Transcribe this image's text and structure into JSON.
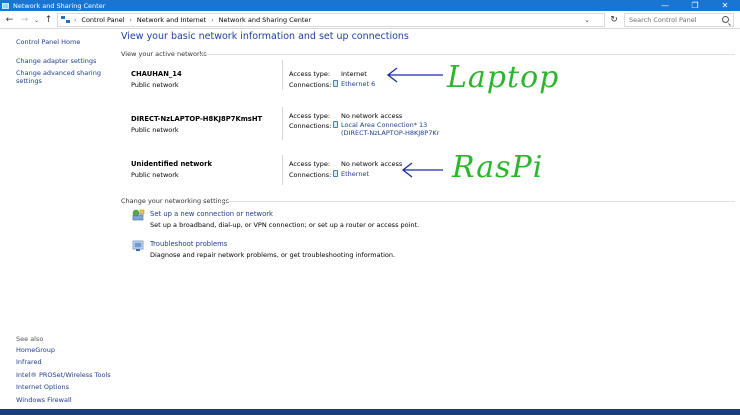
{
  "window": {
    "title": "Network and Sharing Center"
  },
  "breadcrumb": [
    "Control Panel",
    "Network and Internet",
    "Network and Sharing Center"
  ],
  "search": {
    "placeholder": "Search Control Panel"
  },
  "sidebar": {
    "home": "Control Panel Home",
    "adapter": "Change adapter settings",
    "advanced": "Change advanced sharing settings"
  },
  "see_also": {
    "label": "See also",
    "items": [
      "HomeGroup",
      "Infrared",
      "Intel® PROSet/Wireless Tools",
      "Internet Options",
      "Windows Firewall"
    ]
  },
  "main": {
    "title": "View your basic network information and set up connections",
    "active_label": "View your active networks",
    "labels": {
      "access": "Access type:",
      "connections": "Connections:"
    },
    "networks": [
      {
        "name": "CHAUHAN_14",
        "type": "Public network",
        "access": "Internet",
        "connection": "Ethernet 6"
      },
      {
        "name": "DIRECT-NzLAPTOP-H8KJ8P7KmsHT",
        "type": "Public network",
        "access": "No network access",
        "connection_line1": "Local Area Connection* 13",
        "connection_line2": "(DIRECT-NzLAPTOP-H8KJ8P7Kr"
      },
      {
        "name": "Unidentified network",
        "type": "Public network",
        "access": "No network access",
        "connection": "Ethernet"
      }
    ],
    "change_label": "Change your networking settings",
    "tasks": [
      {
        "link": "Set up a new connection or network",
        "desc": "Set up a broadband, dial-up, or VPN connection; or set up a router or access point."
      },
      {
        "link": "Troubleshoot problems",
        "desc": "Diagnose and repair network problems, or get troubleshooting information."
      }
    ]
  },
  "annotations": {
    "laptop": "Laptop",
    "raspi": "RasPi"
  },
  "icons": [
    "network-icon",
    "back-arrow-icon",
    "forward-arrow-icon",
    "recent-dropdown-icon",
    "up-arrow-icon",
    "control-panel-icon",
    "refresh-icon",
    "search-icon",
    "ethernet-icon",
    "new-connection-icon",
    "troubleshoot-icon"
  ],
  "colors": {
    "titlebar": "#1975d2",
    "link": "#1c3d8c",
    "heading": "#1e3fa0",
    "annotation_text": "#2db52d",
    "annotation_arrow": "#1a2aa8"
  }
}
